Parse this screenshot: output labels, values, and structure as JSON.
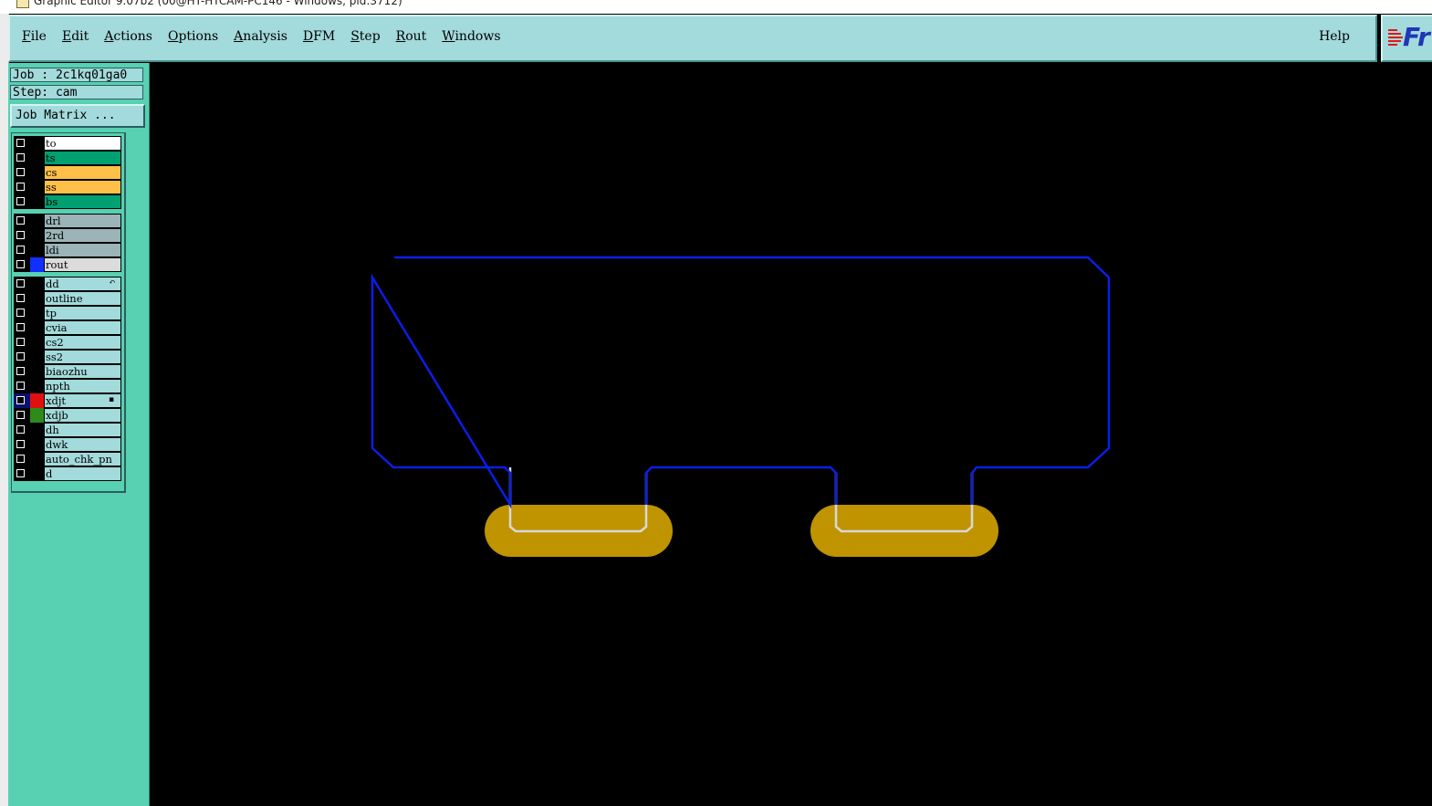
{
  "window": {
    "title": "Graphic Editor 9.07b2 (00@HT-HTCAM-PC146 - Windows, pid:3712)"
  },
  "menu": {
    "items": [
      "File",
      "Edit",
      "Actions",
      "Options",
      "Analysis",
      "DFM",
      "Step",
      "Rout",
      "Windows"
    ],
    "help": "Help"
  },
  "logo": {
    "text": "Fr"
  },
  "job_info": {
    "job": "Job : 2c1kq01ga0",
    "step": "Step: cam",
    "matrix_button": "Job Matrix ..."
  },
  "layers": [
    {
      "name": "to",
      "color": "#ffffff",
      "swatch": "#000000"
    },
    {
      "name": "ts",
      "color": "#00a070",
      "swatch": "#000000"
    },
    {
      "name": "cs",
      "color": "#ffc04a",
      "swatch": "#000000"
    },
    {
      "name": "ss",
      "color": "#ffc04a",
      "swatch": "#000000"
    },
    {
      "name": "bs",
      "color": "#00a070",
      "swatch": "#000000"
    },
    {
      "name": "drl",
      "color": "#9ab4b8",
      "swatch": "#000000",
      "group_start": true
    },
    {
      "name": "2rd",
      "color": "#9ab4b8",
      "swatch": "#000000"
    },
    {
      "name": "ldi",
      "color": "#9ab4b8",
      "swatch": "#000000"
    },
    {
      "name": "rout",
      "color": "#dcdcdc",
      "swatch": "#1030ff"
    },
    {
      "name": "dd",
      "color": "#a3dadb",
      "swatch": "#000000",
      "group_start": true,
      "mark": "↶"
    },
    {
      "name": "outline",
      "color": "#a3dadb",
      "swatch": "#000000"
    },
    {
      "name": "tp",
      "color": "#a3dadb",
      "swatch": "#000000"
    },
    {
      "name": "cvia",
      "color": "#a3dadb",
      "swatch": "#000000"
    },
    {
      "name": "cs2",
      "color": "#a3dadb",
      "swatch": "#000000"
    },
    {
      "name": "ss2",
      "color": "#a3dadb",
      "swatch": "#000000"
    },
    {
      "name": "biaozhu",
      "color": "#a3dadb",
      "swatch": "#000000"
    },
    {
      "name": "npth",
      "color": "#a3dadb",
      "swatch": "#000000"
    },
    {
      "name": "xdjt",
      "color": "#a3dadb",
      "swatch": "#e01010",
      "active": true,
      "mark": "▪"
    },
    {
      "name": "xdjb",
      "color": "#a3dadb",
      "swatch": "#2e8a1a"
    },
    {
      "name": "dh",
      "color": "#a3dadb",
      "swatch": "#000000"
    },
    {
      "name": "dwk",
      "color": "#a3dadb",
      "swatch": "#000000"
    },
    {
      "name": "auto_chk_pn",
      "color": "#a3dadb",
      "swatch": "#000000"
    },
    {
      "name": "d",
      "color": "#a3dadb",
      "swatch": "#000000"
    }
  ],
  "colors": {
    "canvas_bg": "#000000",
    "rout_outline": "#0a1ee8",
    "pad_fill": "#bf9400",
    "pad_outline": "#d8d8d8",
    "panel_bg": "#57d1b1",
    "menu_bg": "#a3dadb"
  }
}
